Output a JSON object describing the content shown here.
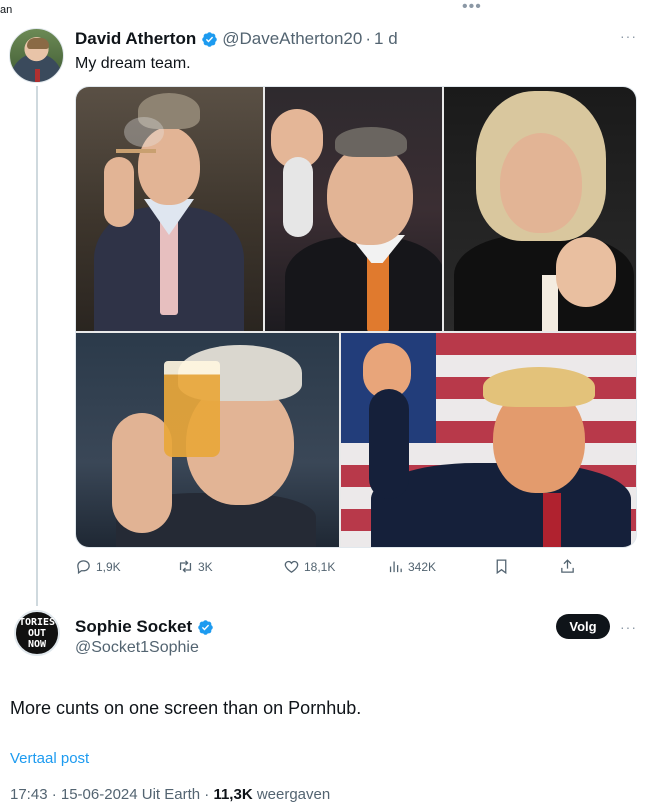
{
  "top": {
    "fragment": "an",
    "dots": "•••"
  },
  "tweet1": {
    "author_name": "David Atherton",
    "handle": "@DaveAtherton20",
    "separator": "·",
    "time": "1 d",
    "more": "···",
    "text": "My dream team.",
    "actions": {
      "replies": "1,9K",
      "reposts": "3K",
      "likes": "18,1K",
      "views": "342K"
    }
  },
  "tweet2": {
    "author_name": "Sophie Socket",
    "handle": "@Socket1Sophie",
    "avatar_lines": [
      "TORIES",
      "OUT",
      "NOW"
    ],
    "follow_label": "Volg",
    "more": "···",
    "text": "More cunts on one screen than on Pornhub.",
    "translate_label": "Vertaal post",
    "timestamp": "17:43 · 15-06-2024 Uit Earth · ",
    "views_count": "11,3K",
    "views_label": " weergaven"
  },
  "colors": {
    "verified": "#1d9bf0",
    "link": "#1d9bf0",
    "muted": "#536471",
    "text": "#0f1419"
  }
}
